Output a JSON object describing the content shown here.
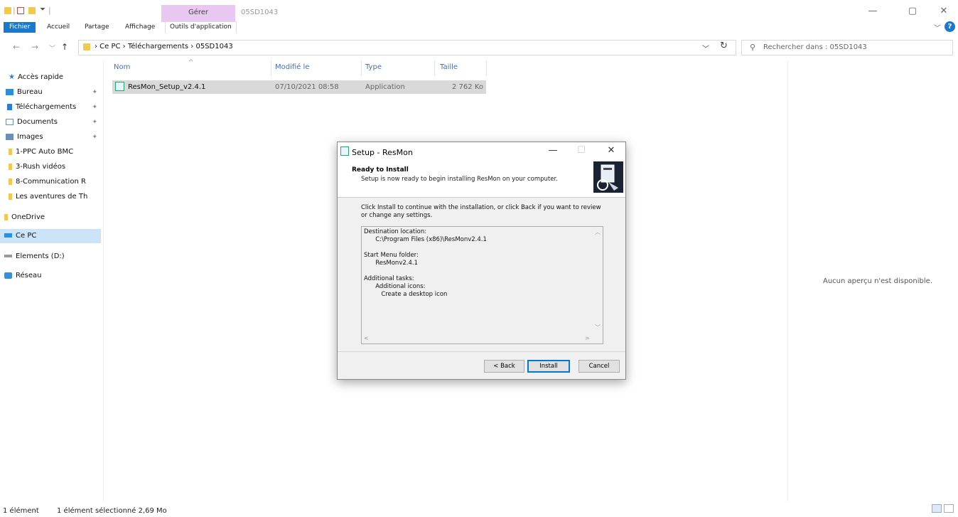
{
  "window": {
    "context_tab": "Gérer",
    "title": "05SD1043",
    "controls": {
      "minimize": "—",
      "maximize": "▢",
      "close": "✕"
    }
  },
  "ribbon": {
    "tabs": [
      "Fichier",
      "Accueil",
      "Partage",
      "Affichage",
      "Outils d'application"
    ],
    "help": "?"
  },
  "address": {
    "path": "›  Ce PC  ›  Téléchargements  ›  05SD1043",
    "search_placeholder": "Rechercher dans : 05SD1043"
  },
  "sidebar": {
    "items": [
      {
        "label": "Accès rapide",
        "icon": "star-icon"
      },
      {
        "label": "Bureau",
        "icon": "desktop-icon",
        "pinned": true
      },
      {
        "label": "Téléchargements",
        "icon": "download-icon",
        "pinned": true
      },
      {
        "label": "Documents",
        "icon": "document-icon",
        "pinned": true
      },
      {
        "label": "Images",
        "icon": "image-icon",
        "pinned": true
      },
      {
        "label": "1-PPC Auto BMC",
        "icon": "folder-icon"
      },
      {
        "label": "3-Rush vidéos",
        "icon": "folder-icon"
      },
      {
        "label": "8-Communication R",
        "icon": "folder-icon"
      },
      {
        "label": "Les aventures de Th",
        "icon": "folder-icon"
      },
      {
        "label": "OneDrive",
        "icon": "folder-icon"
      },
      {
        "label": "Ce PC",
        "icon": "pc-icon",
        "selected": true
      },
      {
        "label": "Elements (D:)",
        "icon": "drive-icon"
      },
      {
        "label": "Réseau",
        "icon": "network-icon"
      }
    ]
  },
  "file_list": {
    "columns": [
      "Nom",
      "Modifié le",
      "Type",
      "Taille"
    ],
    "rows": [
      {
        "name": "ResMon_Setup_v2.4.1",
        "modified": "07/10/2021 08:58",
        "type": "Application",
        "size": "2 762 Ko"
      }
    ]
  },
  "preview": {
    "text": "Aucun aperçu n'est disponible."
  },
  "status": {
    "count": "1 élément",
    "selection": "1 élément sélectionné  2,69 Mo"
  },
  "dialog": {
    "title": "Setup - ResMon",
    "heading": "Ready to Install",
    "subheading": "Setup is now ready to begin installing ResMon on your computer.",
    "body": "Click Install to continue with the installation, or click Back if you want to review or change any settings.",
    "memo_lines": [
      "Destination location:",
      "      C:\\Program Files (x86)\\ResMonv2.4.1",
      "",
      "Start Menu folder:",
      "      ResMonv2.4.1",
      "",
      "Additional tasks:",
      "      Additional icons:",
      "         Create a desktop icon"
    ],
    "buttons": {
      "back": "< Back",
      "install": "Install",
      "cancel": "Cancel"
    },
    "controls": {
      "minimize": "—",
      "maximize": "☐",
      "close": "✕"
    }
  },
  "colors": {
    "accent": "#1979ca",
    "context_tab": "#e8c8f0",
    "selection": "#cce4f7",
    "row_selected": "#d9d9d9"
  }
}
